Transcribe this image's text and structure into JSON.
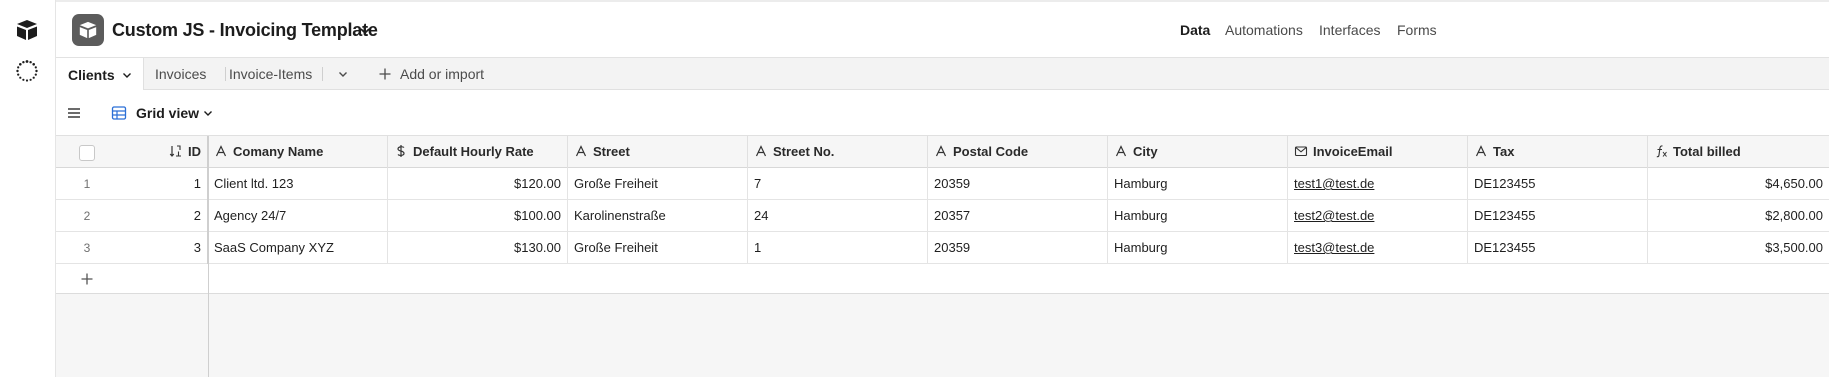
{
  "app": {
    "title": "Custom JS - Invoicing Template",
    "accent_color": "#1d1d1d"
  },
  "top_nav": [
    {
      "label": "Data",
      "active": true
    },
    {
      "label": "Automations",
      "active": false
    },
    {
      "label": "Interfaces",
      "active": false
    },
    {
      "label": "Forms",
      "active": false
    }
  ],
  "tables": [
    {
      "label": "Clients",
      "active": true
    },
    {
      "label": "Invoices",
      "active": false
    },
    {
      "label": "Invoice-Items",
      "active": false
    }
  ],
  "add_or_import_label": "Add or import",
  "view": {
    "name": "Grid view"
  },
  "grid": {
    "columns": [
      {
        "label": "ID",
        "icon": "sort-numeric-icon"
      },
      {
        "label": "Comany Name",
        "icon": "text-field-icon"
      },
      {
        "label": "Default Hourly Rate",
        "icon": "currency-icon"
      },
      {
        "label": "Street",
        "icon": "text-field-icon"
      },
      {
        "label": "Street No.",
        "icon": "text-field-icon"
      },
      {
        "label": "Postal Code",
        "icon": "text-field-icon"
      },
      {
        "label": "City",
        "icon": "text-field-icon"
      },
      {
        "label": "InvoiceEmail",
        "icon": "email-icon"
      },
      {
        "label": "Tax",
        "icon": "text-field-icon"
      },
      {
        "label": "Total billed",
        "icon": "formula-icon"
      }
    ],
    "rows": [
      {
        "num": "1",
        "id": "1",
        "company": "Client ltd. 123",
        "rate": "$120.00",
        "street": "Große Freiheit",
        "street_no": "7",
        "postal": "20359",
        "city": "Hamburg",
        "email": "test1@test.de",
        "tax": "DE123455",
        "total": "$4,650.00"
      },
      {
        "num": "2",
        "id": "2",
        "company": "Agency 24/7",
        "rate": "$100.00",
        "street": "Karolinenstraße",
        "street_no": "24",
        "postal": "20357",
        "city": "Hamburg",
        "email": "test2@test.de",
        "tax": "DE123455",
        "total": "$2,800.00"
      },
      {
        "num": "3",
        "id": "3",
        "company": "SaaS Company XYZ",
        "rate": "$130.00",
        "street": "Große Freiheit",
        "street_no": "1",
        "postal": "20359",
        "city": "Hamburg",
        "email": "test3@test.de",
        "tax": "DE123455",
        "total": "$3,500.00"
      }
    ]
  }
}
